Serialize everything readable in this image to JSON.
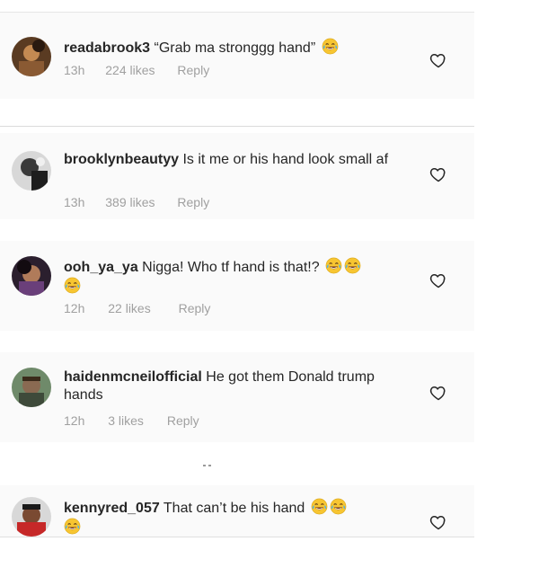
{
  "comments": [
    {
      "username": "readabrook3",
      "text": "“Grab ma stronggg hand”",
      "time": "13h",
      "likes": "224 likes",
      "reply": "Reply",
      "emojis": [
        "crying-laughing-emoji"
      ]
    },
    {
      "username": "brooklynbeautyy",
      "text": "Is it me or his hand look small af",
      "time": "13h",
      "likes": "389 likes",
      "reply": "Reply",
      "emojis": []
    },
    {
      "username": "ooh_ya_ya",
      "text": "Nigga! Who tf hand is that!?",
      "time": "12h",
      "likes": "22 likes",
      "reply": "Reply",
      "emojis": [
        "crying-laughing-emoji",
        "crying-laughing-emoji",
        "crying-laughing-emoji"
      ]
    },
    {
      "username": "haidenmcneilofficial",
      "text": "He got them Donald trump hands",
      "time": "12h",
      "likes": "3 likes",
      "reply": "Reply",
      "emojis": []
    },
    {
      "username": "kennyred_057",
      "text": "That can’t be his hand",
      "emojis": [
        "crying-laughing-emoji",
        "crying-laughing-emoji",
        "crying-laughing-emoji"
      ]
    }
  ],
  "icons": {
    "like": "heart-outline-icon",
    "emoji": "crying-laughing-emoji"
  },
  "colors": {
    "text": "#262626",
    "meta": "#a0a0a0",
    "panel": "#fafafa"
  }
}
